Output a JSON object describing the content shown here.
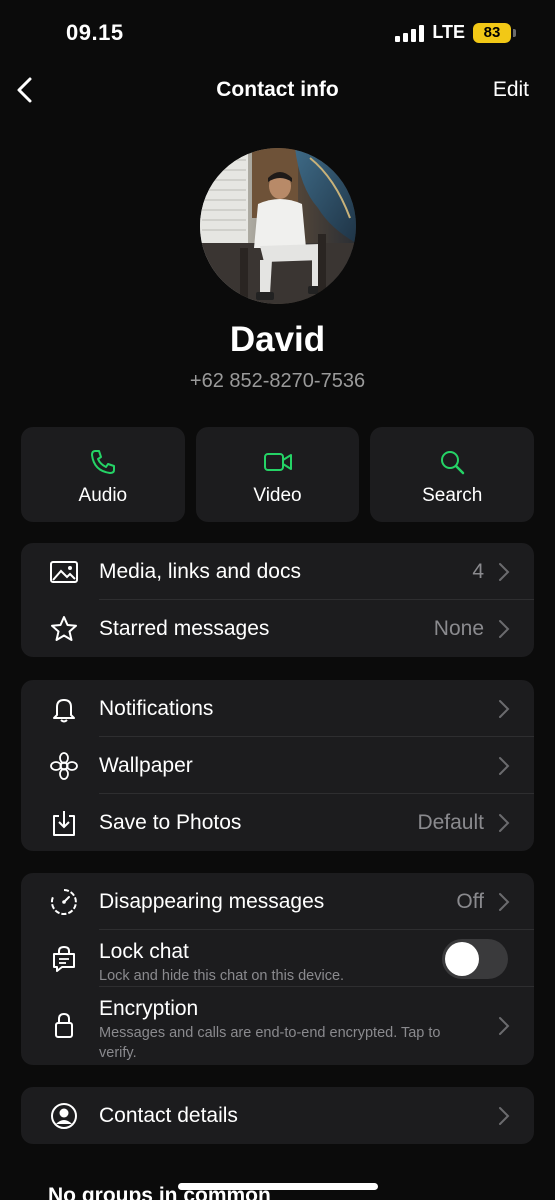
{
  "status_bar": {
    "time": "09.15",
    "network": "LTE",
    "battery": "83"
  },
  "nav": {
    "title": "Contact info",
    "edit_label": "Edit",
    "back_icon": "chevron-left-icon"
  },
  "contact": {
    "name": "David",
    "phone": "+62 852-8270-7536"
  },
  "actions": [
    {
      "label": "Audio",
      "icon": "phone-icon"
    },
    {
      "label": "Video",
      "icon": "video-icon"
    },
    {
      "label": "Search",
      "icon": "search-icon"
    }
  ],
  "section1": [
    {
      "label": "Media, links and docs",
      "value": "4",
      "icon": "image-icon"
    },
    {
      "label": "Starred messages",
      "value": "None",
      "icon": "star-icon"
    }
  ],
  "section2": [
    {
      "label": "Notifications",
      "value": "",
      "icon": "bell-icon"
    },
    {
      "label": "Wallpaper",
      "value": "",
      "icon": "flower-icon"
    },
    {
      "label": "Save to Photos",
      "value": "Default",
      "icon": "download-icon"
    }
  ],
  "section3": {
    "disappearing": {
      "label": "Disappearing messages",
      "value": "Off",
      "icon": "timer-icon"
    },
    "lock": {
      "label": "Lock chat",
      "sub": "Lock and hide this chat on this device.",
      "icon": "lock-chat-icon",
      "enabled": false
    },
    "encryption": {
      "label": "Encryption",
      "sub": "Messages and calls are end-to-end encrypted. Tap to verify.",
      "icon": "lock-icon"
    }
  },
  "section4": [
    {
      "label": "Contact details",
      "icon": "person-circle-icon"
    }
  ],
  "groups_text": "No groups in common",
  "colors": {
    "accent": "#25d366",
    "background": "#0b0b0b",
    "card": "#1c1c1e",
    "secondary_text": "#8a8a8e",
    "battery": "#f2c816"
  }
}
